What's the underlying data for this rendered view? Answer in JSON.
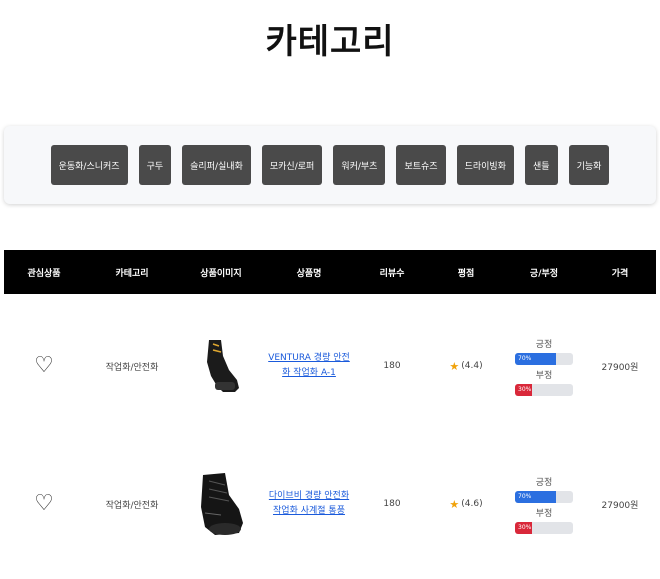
{
  "page": {
    "title": "카테고리"
  },
  "categories": [
    "운동화/스니커즈",
    "구두",
    "슬리퍼/실내화",
    "모카신/로퍼",
    "워커/부츠",
    "보트슈즈",
    "드라이빙화",
    "샌들",
    "기능화"
  ],
  "table": {
    "headers": [
      "관심상품",
      "카테고리",
      "상품이미지",
      "상품명",
      "리뷰수",
      "평점",
      "긍/부정",
      "가격"
    ],
    "rows": [
      {
        "category": "작업화/안전화",
        "name_line1": "VENTURA 경량 안전",
        "name_line2": "화 작업화 A-1",
        "reviews": "180",
        "rating": "(4.4)",
        "positive_label": "긍정",
        "positive_pct": "70%",
        "positive_value": 70,
        "negative_label": "부정",
        "negative_pct": "30%",
        "negative_value": 30,
        "price": "27900원"
      },
      {
        "category": "작업화/안전화",
        "name_line1": "다이브비 경량 안전화",
        "name_line2": "작업화 사계절 통풍",
        "reviews": "180",
        "rating": "(4.6)",
        "positive_label": "긍정",
        "positive_pct": "70%",
        "positive_value": 70,
        "negative_label": "부정",
        "negative_pct": "30%",
        "negative_value": 30,
        "price": "27900원"
      }
    ]
  },
  "colors": {
    "header_bg": "#000000",
    "button_bg": "#4a4a4a",
    "positive": "#2b6fe0",
    "negative": "#d9283a",
    "link": "#1a5adb",
    "star": "#f0a20a"
  },
  "icons": {
    "wishlist": "heart-outline-icon",
    "rating": "star-icon"
  }
}
